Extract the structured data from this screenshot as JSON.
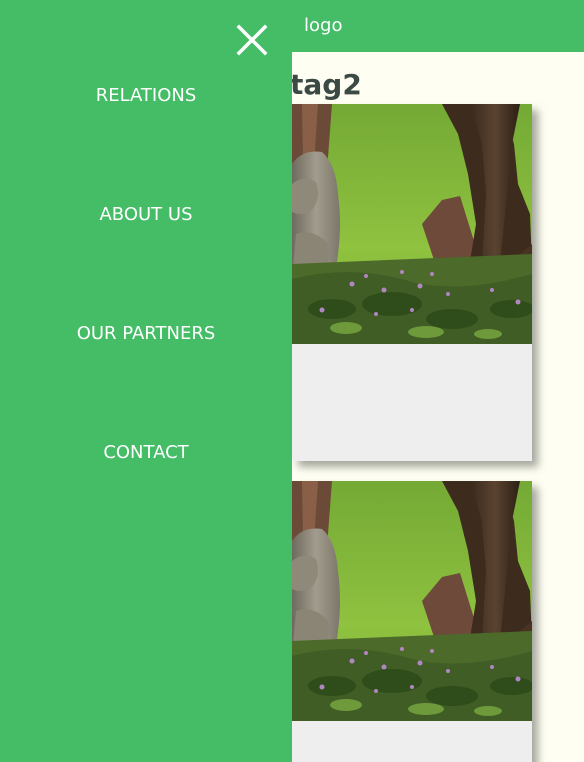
{
  "header": {
    "logo_text": "logo",
    "background_color": "#44bd66"
  },
  "main": {
    "heading": "tag2",
    "cards": [
      {
        "image": "garden-statue-photo"
      },
      {
        "image": "garden-statue-photo"
      }
    ]
  },
  "drawer": {
    "close_icon": "close-icon",
    "background_color": "#44bd66",
    "items": [
      {
        "label": "RELATIONS"
      },
      {
        "label": "ABOUT US"
      },
      {
        "label": "OUR PARTNERS"
      },
      {
        "label": "CONTACT"
      }
    ]
  }
}
